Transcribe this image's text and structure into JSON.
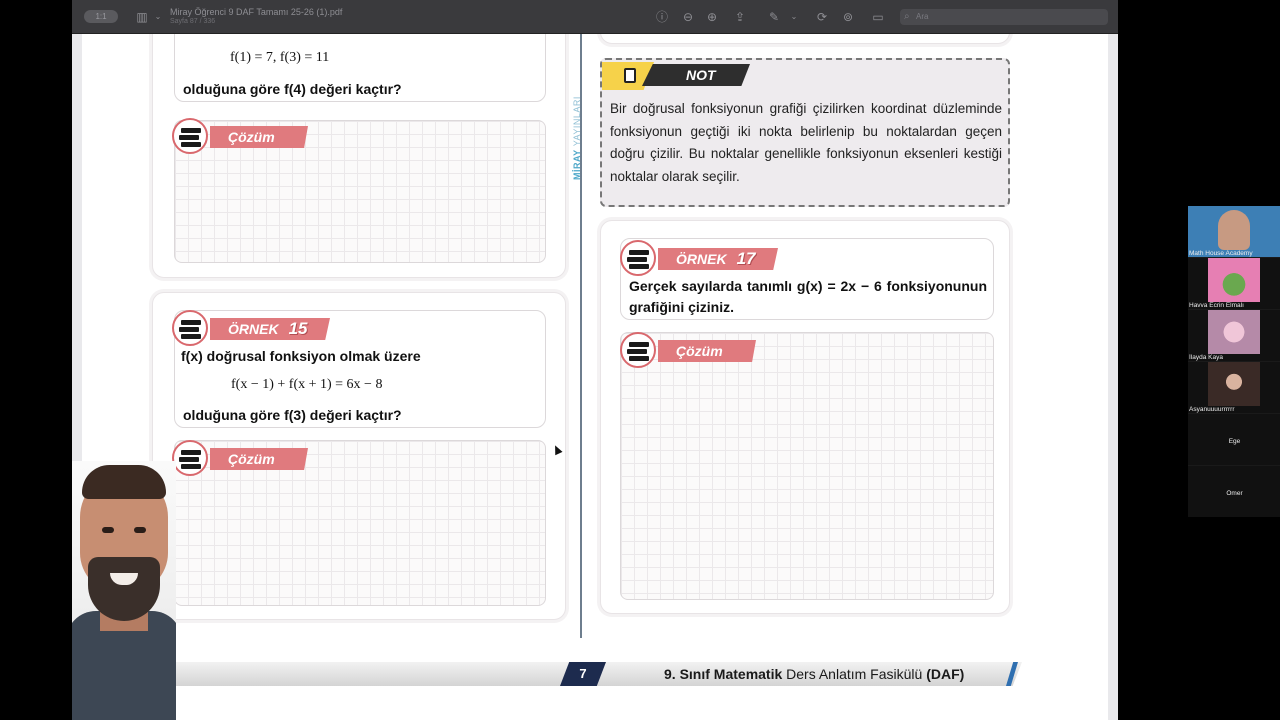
{
  "viewer": {
    "sidebar_pill": "1:1",
    "doc_title": "Miray Öğrenci 9 DAF Tamamı 25-26 (1).pdf",
    "page_info": "Sayfa 87 / 336",
    "search_placeholder": "Ara"
  },
  "page": {
    "brand": {
      "strong": "MİRAY",
      "light": "YAYINLARI"
    },
    "left": {
      "prev": {
        "math": "f(1) = 7,   f(3) = 11",
        "question": "olduğuna göre f(4)  değeri kaçtır?",
        "solution_label": "Çözüm"
      },
      "example15": {
        "label": "ÖRNEK",
        "number": "15",
        "intro": "f(x) doğrusal fonksiyon olmak üzere",
        "math": "f(x − 1) + f(x + 1) = 6x − 8",
        "question": "olduğuna göre  f(3)  değeri kaçtır?",
        "solution_label": "Çözüm"
      }
    },
    "right": {
      "note": {
        "label": "NOT",
        "text": "Bir doğrusal fonksiyonun grafiği çizilirken koordinat düzleminde fonksiyonun geçtiği iki nokta belirlenip bu noktalardan geçen doğru çizilir. Bu noktalar genellikle fonksiyonun eksenleri kestiği noktalar olarak seçilir."
      },
      "example17": {
        "label": "ÖRNEK",
        "number": "17",
        "question": "Gerçek sayılarda tanımlı g(x) = 2x − 6 fonksiyonunun grafiğini çiziniz.",
        "solution_label": "Çözüm"
      }
    },
    "footer": {
      "page_number": "7",
      "grade": "9. Sınıf",
      "subject": "Matematik",
      "rest": "Ders Anlatım Fasikülü",
      "code": "(DAF)"
    }
  },
  "participants": [
    {
      "name": "Math House Academy"
    },
    {
      "name": "Havva Ecrin Elmalı"
    },
    {
      "name": "İlayda Kaya"
    },
    {
      "name": "Asyanuuuurrrrrr"
    },
    {
      "name": "Ege"
    },
    {
      "name": "Ömer"
    }
  ],
  "colors": {
    "ribbon": "#e07a7e",
    "note_tag": "#2e2e2e",
    "note_icon": "#f6d24a",
    "footer_page": "#1d2b4e",
    "brand": "#4fa8c9"
  }
}
